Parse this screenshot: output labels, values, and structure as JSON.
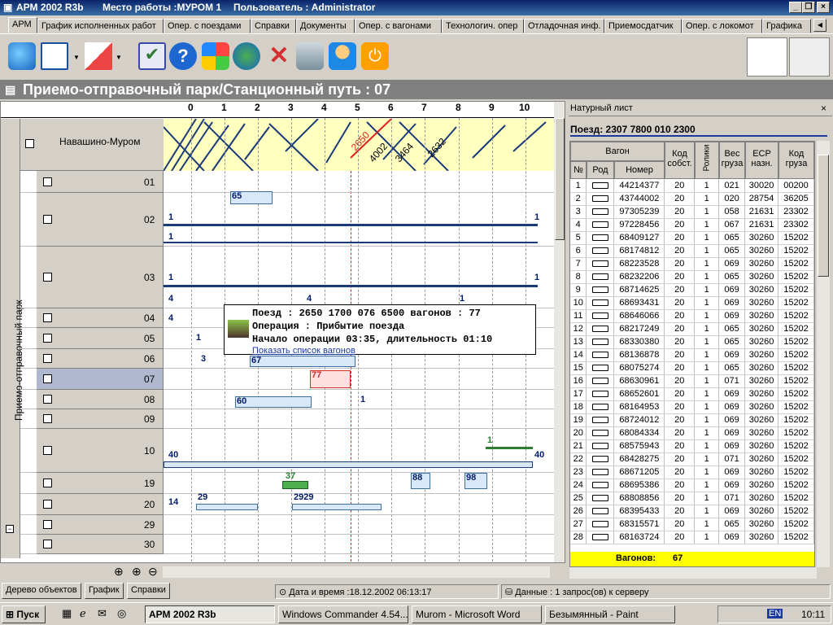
{
  "window": {
    "title": "АРМ 2002 R3b",
    "workplace": "Место работы :МУРОМ 1",
    "user": "Пользователь : Administrator"
  },
  "tabs": [
    "АРМ",
    "График исполненных работ",
    "Опер. с поездами",
    "Справки",
    "Документы",
    "Опер. с вагонами",
    "Технологич. опер",
    "Отладочная инф.",
    "Приемосдатчик",
    "Опер. с локомот",
    "Графика"
  ],
  "header": {
    "title": "Приемо-отправочный парк/Станционный путь : 07"
  },
  "grid": {
    "hours": [
      "0",
      "1",
      "2",
      "3",
      "4",
      "5",
      "6",
      "7",
      "8",
      "9",
      "10"
    ],
    "direction": "Навашино-Муром",
    "group_label": "Приемо-отправочный парк",
    "tracks": [
      "01",
      "02",
      "03",
      "04",
      "05",
      "06",
      "07",
      "08",
      "09",
      "10",
      "19",
      "20",
      "29",
      "30"
    ],
    "selected_track": "07",
    "train_labels": [
      "2650",
      "2632",
      "3464",
      "4002"
    ],
    "marks": {
      "m65": "65",
      "m1a": "1",
      "m1b": "1",
      "m1c": "1",
      "m1d": "1",
      "m1e": "1",
      "m4a": "4",
      "m4b": "4",
      "m4c": "4",
      "m1f": "1",
      "m3": "3",
      "m67": "67",
      "m77": "77",
      "m60": "60",
      "m1g": "1",
      "m1h": "1",
      "m1i": "1",
      "m40a": "40",
      "m40b": "40",
      "m37": "37",
      "m88": "88",
      "m98": "98",
      "m14": "14",
      "m29a": "29",
      "m29b": "2929"
    }
  },
  "popup": {
    "line1": "Поезд : 2650 1700 076 6500  вагонов : 77",
    "line2": "Операция : Прибытие поезда",
    "line3": "Начало операции  03:35, длительность  01:10",
    "link": "Показать список вагонов"
  },
  "natural_sheet": {
    "title": "Натурный лист",
    "train": "Поезд: 2307 7800 010 2300",
    "headers": {
      "wagon": "Вагон",
      "n": "№",
      "kind": "Род",
      "number": "Номер",
      "owner": "Код собст.",
      "rollers": "Ролики",
      "weight": "Вес груза",
      "esr": "ЕСР назн.",
      "cargo": "Код груза"
    },
    "rows": [
      [
        "1",
        "44214377",
        "20",
        "1",
        "021",
        "30020",
        "00200"
      ],
      [
        "2",
        "43744002",
        "20",
        "1",
        "020",
        "28754",
        "36205"
      ],
      [
        "3",
        "97305239",
        "20",
        "1",
        "058",
        "21631",
        "23302"
      ],
      [
        "4",
        "97228456",
        "20",
        "1",
        "067",
        "21631",
        "23302"
      ],
      [
        "5",
        "68409127",
        "20",
        "1",
        "065",
        "30260",
        "15202"
      ],
      [
        "6",
        "68174812",
        "20",
        "1",
        "065",
        "30260",
        "15202"
      ],
      [
        "7",
        "68223528",
        "20",
        "1",
        "069",
        "30260",
        "15202"
      ],
      [
        "8",
        "68232206",
        "20",
        "1",
        "065",
        "30260",
        "15202"
      ],
      [
        "9",
        "68714625",
        "20",
        "1",
        "069",
        "30260",
        "15202"
      ],
      [
        "10",
        "68693431",
        "20",
        "1",
        "069",
        "30260",
        "15202"
      ],
      [
        "11",
        "68646066",
        "20",
        "1",
        "069",
        "30260",
        "15202"
      ],
      [
        "12",
        "68217249",
        "20",
        "1",
        "065",
        "30260",
        "15202"
      ],
      [
        "13",
        "68330380",
        "20",
        "1",
        "065",
        "30260",
        "15202"
      ],
      [
        "14",
        "68136878",
        "20",
        "1",
        "069",
        "30260",
        "15202"
      ],
      [
        "15",
        "68075274",
        "20",
        "1",
        "065",
        "30260",
        "15202"
      ],
      [
        "16",
        "68630961",
        "20",
        "1",
        "071",
        "30260",
        "15202"
      ],
      [
        "17",
        "68652601",
        "20",
        "1",
        "069",
        "30260",
        "15202"
      ],
      [
        "18",
        "68164953",
        "20",
        "1",
        "069",
        "30260",
        "15202"
      ],
      [
        "19",
        "68724012",
        "20",
        "1",
        "069",
        "30260",
        "15202"
      ],
      [
        "20",
        "68084334",
        "20",
        "1",
        "069",
        "30260",
        "15202"
      ],
      [
        "21",
        "68575943",
        "20",
        "1",
        "069",
        "30260",
        "15202"
      ],
      [
        "22",
        "68428275",
        "20",
        "1",
        "071",
        "30260",
        "15202"
      ],
      [
        "23",
        "68671205",
        "20",
        "1",
        "069",
        "30260",
        "15202"
      ],
      [
        "24",
        "68695386",
        "20",
        "1",
        "069",
        "30260",
        "15202"
      ],
      [
        "25",
        "68808856",
        "20",
        "1",
        "071",
        "30260",
        "15202"
      ],
      [
        "26",
        "68395433",
        "20",
        "1",
        "069",
        "30260",
        "15202"
      ],
      [
        "27",
        "68315571",
        "20",
        "1",
        "065",
        "30260",
        "15202"
      ],
      [
        "28",
        "68163724",
        "20",
        "1",
        "069",
        "30260",
        "15202"
      ]
    ],
    "total_label": "Вагонов:",
    "total_value": "67"
  },
  "bottom_tabs": [
    "Дерево объектов",
    "График",
    "Справки"
  ],
  "status": {
    "datetime": "Дата и время :18.12.2002 06:13:17",
    "data": "Данные : 1 запрос(ов) к серверу"
  },
  "taskbar": {
    "start": "Пуск",
    "tasks": [
      "АРМ 2002 R3b",
      "Windows Commander 4.54...",
      "Murom - Microsoft Word",
      "Безымянный - Paint"
    ],
    "lang": "EN",
    "clock": "10:11"
  }
}
